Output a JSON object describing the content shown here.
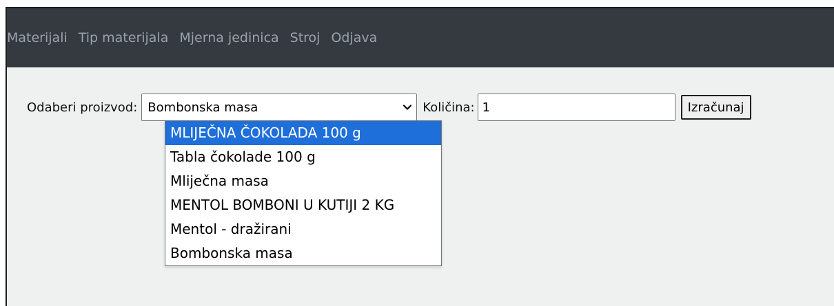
{
  "nav": {
    "items": [
      {
        "label": "Materijali"
      },
      {
        "label": "Tip materijala"
      },
      {
        "label": "Mjerna jedinica"
      },
      {
        "label": "Stroj"
      },
      {
        "label": "Odjava"
      }
    ]
  },
  "form": {
    "product_label": "Odaberi proizvod:",
    "product_selected": "Bombonska masa",
    "quantity_label": "Količina:",
    "quantity_value": "1",
    "calculate_label": "Izračunaj"
  },
  "dropdown": {
    "options": [
      {
        "label": "MLIJEČNA ČOKOLADA 100 g",
        "highlighted": true
      },
      {
        "label": "Tabla čokolade 100 g",
        "highlighted": false
      },
      {
        "label": "Mliječna masa",
        "highlighted": false
      },
      {
        "label": "MENTOL BOMBONI U KUTIJI 2 KG",
        "highlighted": false
      },
      {
        "label": "Mentol - dražirani",
        "highlighted": false
      },
      {
        "label": "Bombonska masa",
        "highlighted": false
      }
    ]
  },
  "colors": {
    "navbar_bg": "#343a40",
    "nav_text": "#9aa1a8",
    "page_bg": "#eef1ef",
    "highlight": "#1e6fd9"
  },
  "icons": {
    "select_arrow": "chevron-down-icon"
  }
}
